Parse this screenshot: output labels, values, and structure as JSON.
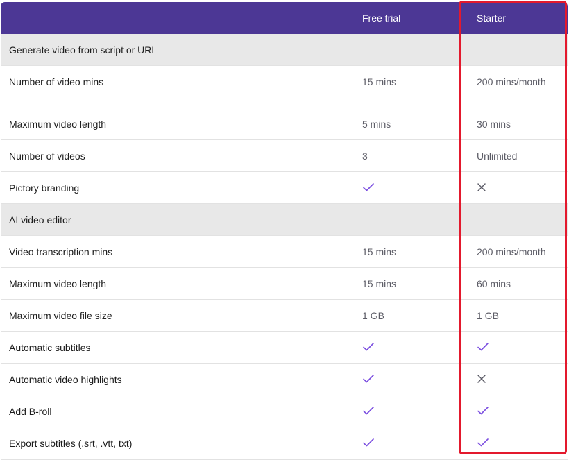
{
  "header": {
    "col1": "Free trial",
    "col2": "Starter"
  },
  "rows": [
    {
      "type": "section",
      "label": "Generate video from script or URL"
    },
    {
      "type": "row",
      "label": "Number of video mins",
      "free": "15 mins",
      "starter": "200 mins/month"
    },
    {
      "type": "row",
      "label": "Maximum video length",
      "free": "5 mins",
      "starter": "30 mins"
    },
    {
      "type": "row",
      "label": "Number of videos",
      "free": "3",
      "starter": "Unlimited"
    },
    {
      "type": "row",
      "label": "Pictory branding",
      "free": "check-icon",
      "starter": "cross-icon"
    },
    {
      "type": "section",
      "label": "AI video editor"
    },
    {
      "type": "row",
      "label": "Video transcription mins",
      "free": "15 mins",
      "starter": "200 mins/month"
    },
    {
      "type": "row",
      "label": "Maximum video length",
      "free": "15 mins",
      "starter": "60 mins"
    },
    {
      "type": "row",
      "label": "Maximum video file size",
      "free": "1 GB",
      "starter": "1 GB"
    },
    {
      "type": "row",
      "label": "Automatic subtitles",
      "free": "check-icon",
      "starter": "check-icon"
    },
    {
      "type": "row",
      "label": "Automatic video highlights",
      "free": "check-icon",
      "starter": "cross-icon"
    },
    {
      "type": "row",
      "label": "Add B-roll",
      "free": "check-icon",
      "starter": "check-icon"
    },
    {
      "type": "row",
      "label": "Export subtitles (.srt, .vtt, txt)",
      "free": "check-icon",
      "starter": "check-icon"
    }
  ],
  "colors": {
    "header_bg": "#4c3795",
    "section_bg": "#e8e8e8",
    "check": "#7a4de0",
    "cross": "#5b5b66",
    "highlight": "#e3192d"
  }
}
